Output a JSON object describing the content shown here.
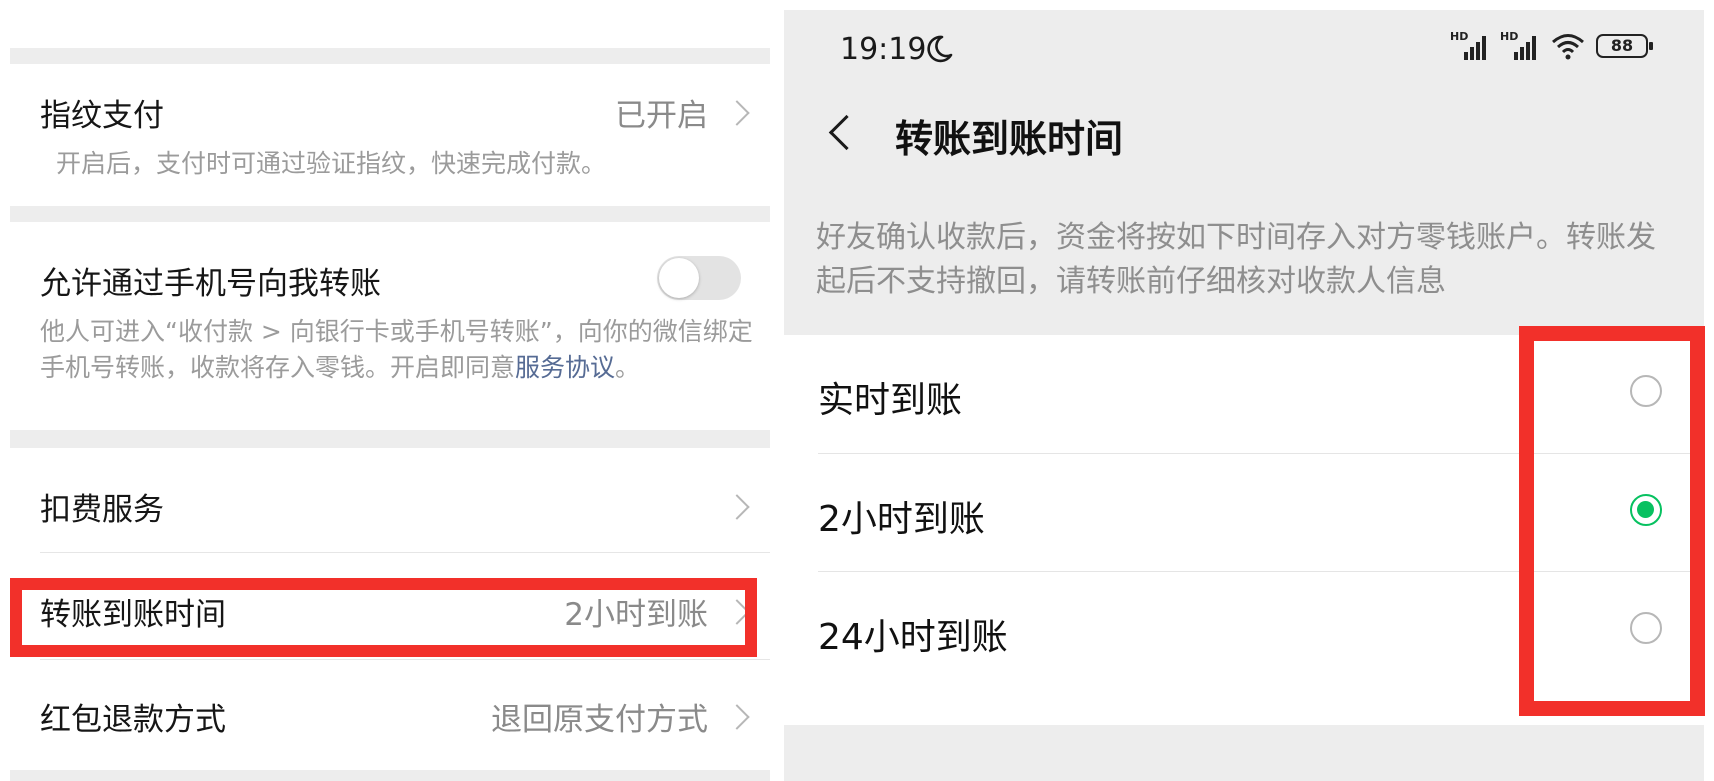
{
  "left_panel": {
    "fingerprint": {
      "title": "指纹支付",
      "value": "已开启",
      "description": "开启后，支付时可通过验证指纹，快速完成付款。"
    },
    "phone_transfer": {
      "title": "允许通过手机号向我转账",
      "description_before_link": "他人可进入“收付款 > 向银行卡或手机号转账”，向你的微信绑定手机号转账，收款将存入零钱。开启即同意",
      "link": "服务协议",
      "description_after_link": "。",
      "toggle_on": false
    },
    "deduction": {
      "title": "扣费服务"
    },
    "transfer_time": {
      "title": "转账到账时间",
      "value": "2小时到账"
    },
    "red_packet_refund": {
      "title": "红包退款方式",
      "value": "退回原支付方式"
    }
  },
  "right_panel": {
    "status_bar": {
      "time": "19:19",
      "moon_icon": "moon-icon",
      "signal_hd_label": "HD",
      "battery": "88"
    },
    "header": {
      "title": "转账到账时间"
    },
    "hint": "好友确认收款后，资金将按如下时间存入对方零钱账户。转账发起后不支持撤回，请转账前仔细核对收款人信息",
    "options": [
      {
        "label": "实时到账",
        "selected": false
      },
      {
        "label": "2小时到账",
        "selected": true
      },
      {
        "label": "24小时到账",
        "selected": false
      }
    ]
  },
  "colors": {
    "accent_green": "#07c160",
    "highlight_red": "#f2302a",
    "link_blue": "#566b94",
    "background_gray": "#ededed"
  }
}
